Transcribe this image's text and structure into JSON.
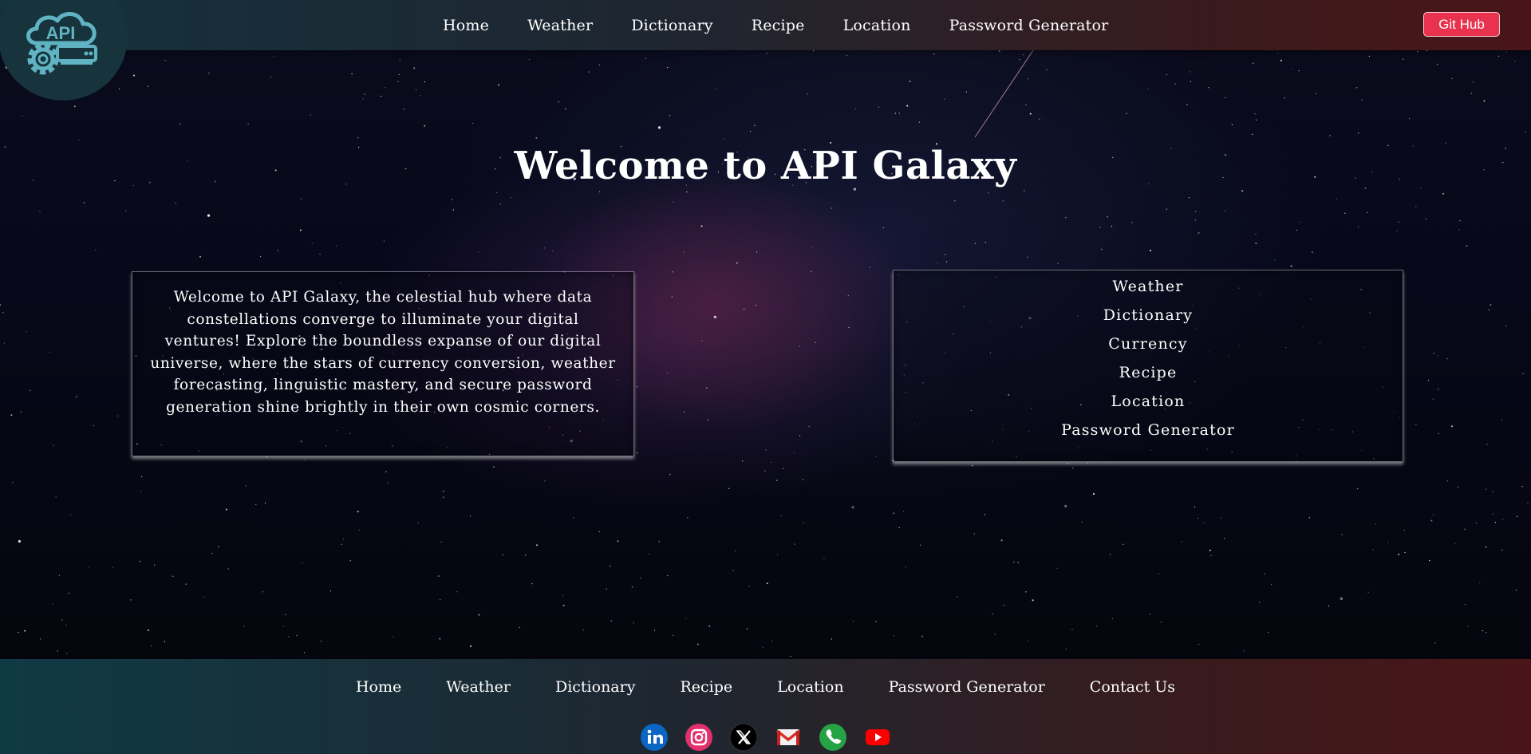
{
  "nav": {
    "links": [
      "Home",
      "Weather",
      "Dictionary",
      "Recipe",
      "Location",
      "Password Generator"
    ],
    "git_button": "Git Hub",
    "logo_text": "API"
  },
  "hero": {
    "title": "Welcome to API Galaxy"
  },
  "intro_card": {
    "text": "Welcome to API Galaxy, the celestial hub where data constellations converge to illuminate your digital ventures! Explore the boundless expanse of our digital universe, where the stars of currency conversion, weather forecasting, linguistic mastery, and secure password generation shine brightly in their own cosmic corners."
  },
  "services_card": {
    "items": [
      "Weather",
      "Dictionary",
      "Currency",
      "Recipe",
      "Location",
      "Password Generator"
    ]
  },
  "footer": {
    "links": [
      "Home",
      "Weather",
      "Dictionary",
      "Recipe",
      "Location",
      "Password Generator",
      "Contact Us"
    ],
    "socials": [
      "linkedin-icon",
      "instagram-icon",
      "x-icon",
      "gmail-icon",
      "phone-icon",
      "youtube-icon"
    ]
  },
  "colors": {
    "git_button": "#e8324e",
    "nav_left": "#14323c",
    "nav_right": "#4a1518"
  }
}
